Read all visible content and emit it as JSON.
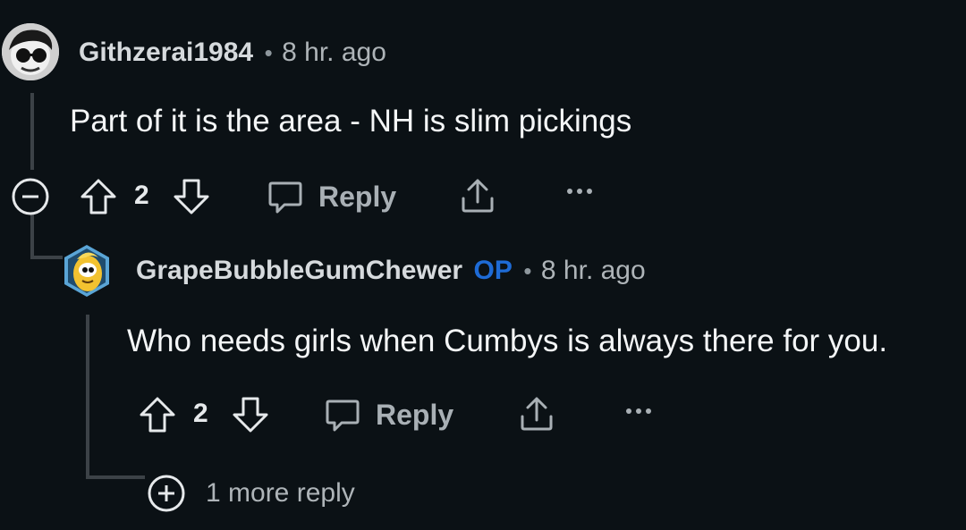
{
  "comments": [
    {
      "username": "Githzerai1984",
      "separator": "•",
      "time": "8 hr. ago",
      "body": "Part of it is the area - NH is slim pickings",
      "votes": "2",
      "reply_label": "Reply",
      "avatar_icon": "avatar-sunglasses-icon",
      "collapse_icon": "collapse-minus-icon"
    },
    {
      "username": "GrapeBubbleGumChewer",
      "op_badge": "OP",
      "separator": "•",
      "time": "8 hr. ago",
      "body": "Who needs girls when Cumbys is always there for you.",
      "votes": "2",
      "reply_label": "Reply",
      "avatar_icon": "avatar-snoo-icon"
    }
  ],
  "more_replies": {
    "label": "1 more reply",
    "icon": "expand-plus-icon"
  },
  "colors": {
    "background": "#0b1115",
    "op_badge": "#1e6bd6",
    "thread_line": "#3c4247"
  }
}
